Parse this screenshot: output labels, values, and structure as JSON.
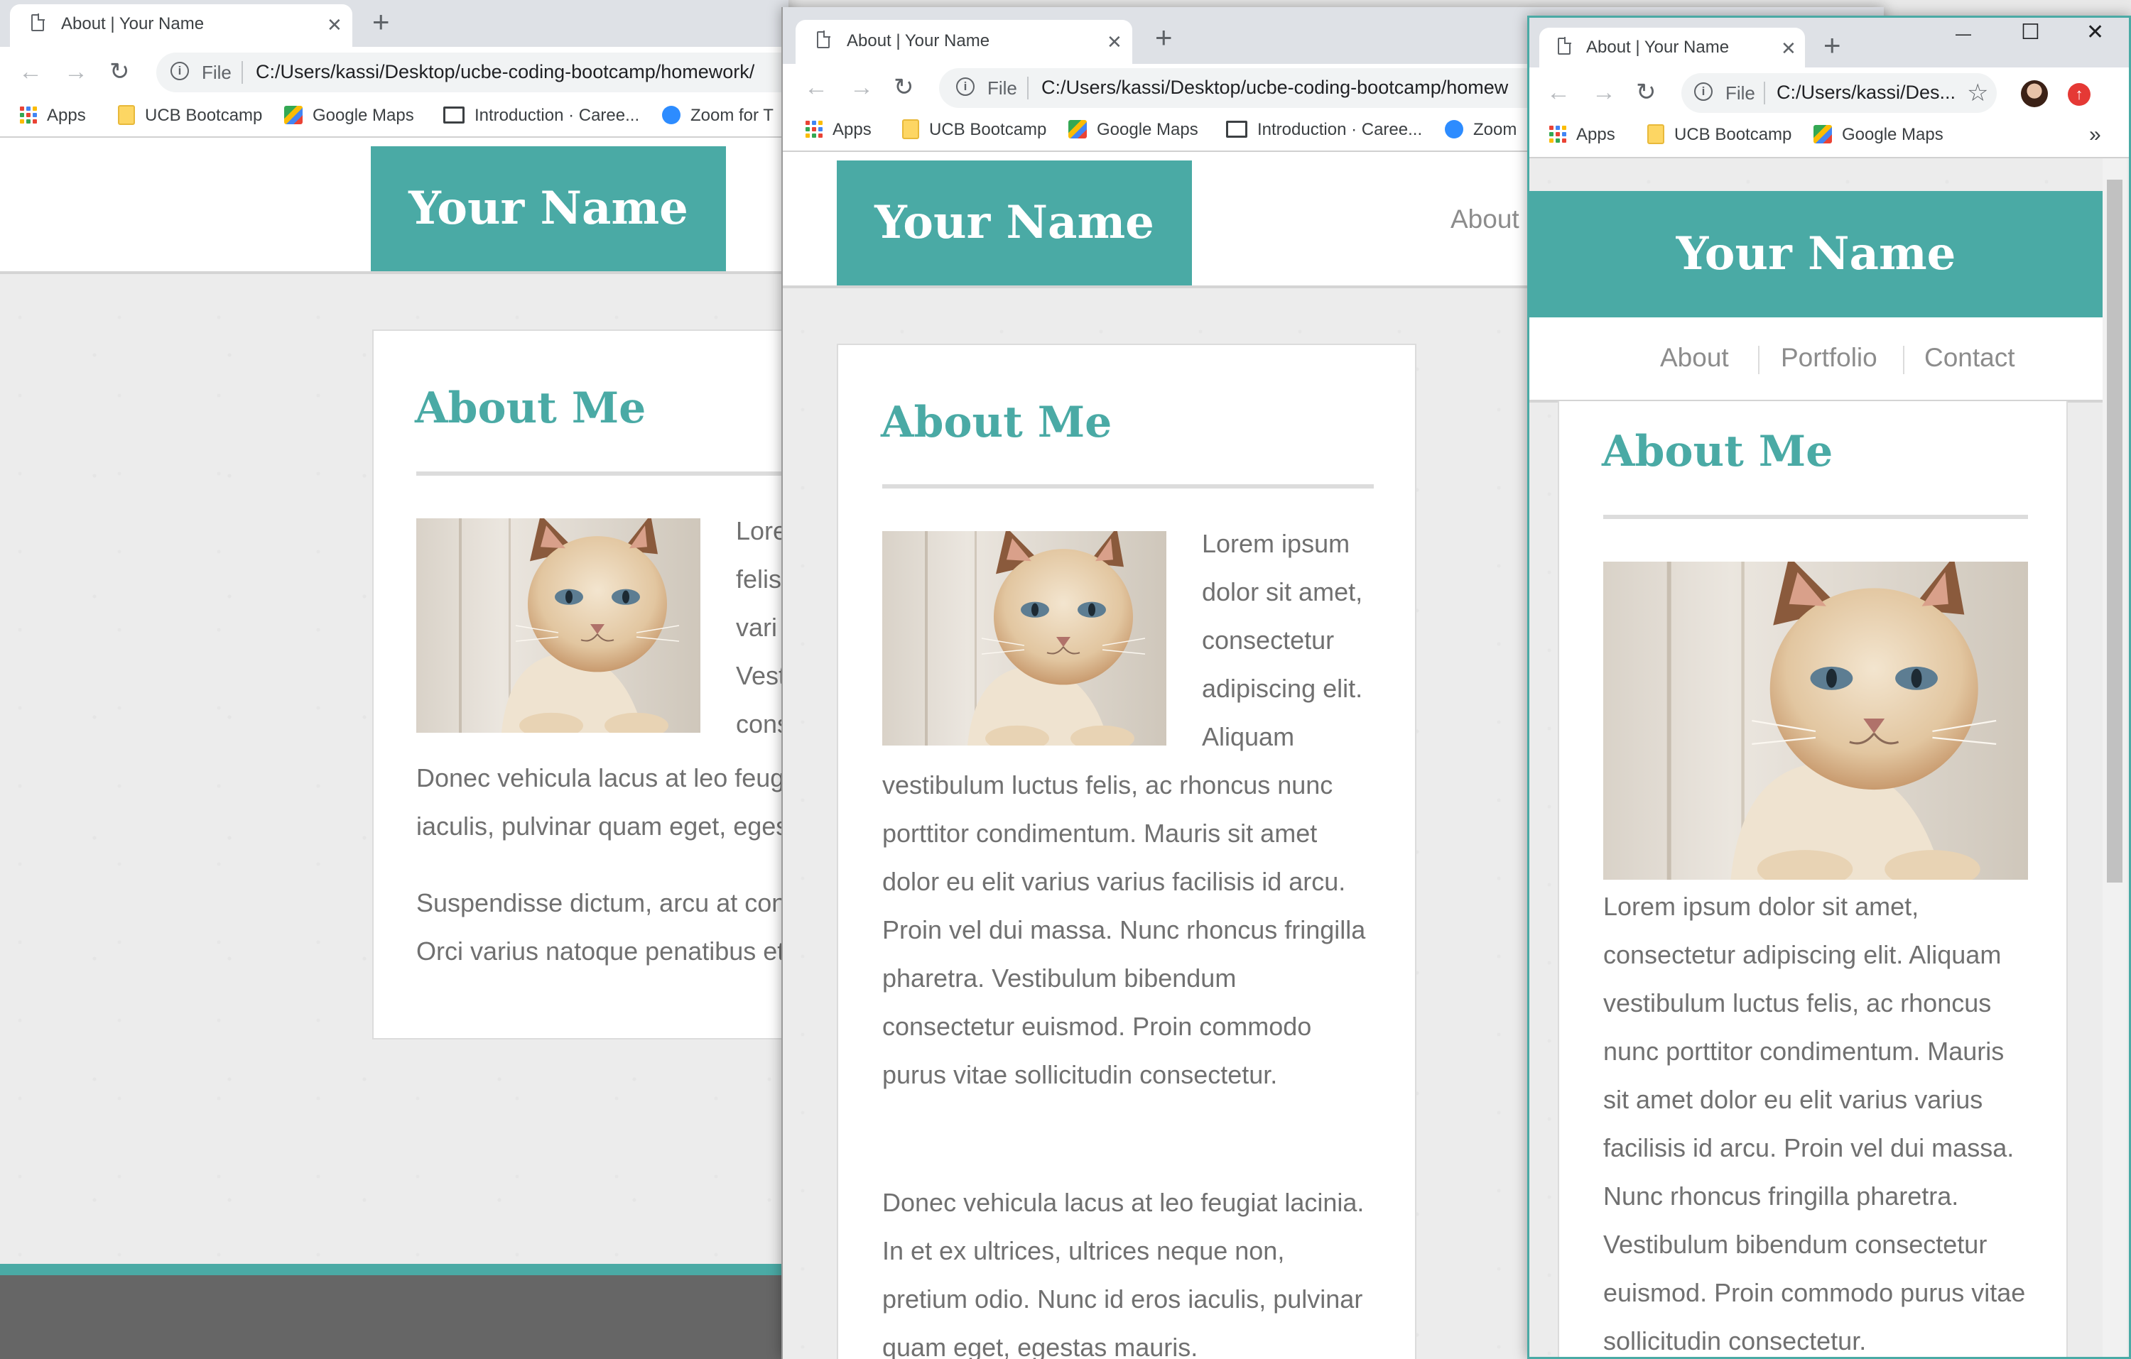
{
  "tab_title": "About | Your Name",
  "omnibox": {
    "file_label": "File",
    "w1_url": "C:/Users/kassi/Desktop/ucbe-coding-bootcamp/homework/",
    "w2_url": "C:/Users/kassi/Desktop/ucbe-coding-bootcamp/homew",
    "w3_url": "C:/Users/kassi/Des..."
  },
  "bookmarks": {
    "apps": "Apps",
    "ucb": "UCB Bootcamp",
    "maps": "Google Maps",
    "intro": "Introduction · Caree...",
    "zoom_w1": "Zoom for T",
    "zoom_w2": "Zoom",
    "overflow": "»"
  },
  "icons": {
    "back": "←",
    "forward": "→",
    "reload": "↻",
    "close": "✕",
    "plus": "+",
    "star": "☆",
    "minimize": "—",
    "maximize": "☐",
    "info": "i"
  },
  "site": {
    "brand": "Your Name",
    "nav": {
      "about": "About",
      "portfolio": "Portfolio",
      "contact": "Contact"
    },
    "heading": "About Me"
  },
  "w1_text": {
    "side_lines": [
      "Lore",
      "felis",
      "vari",
      "Vest",
      "cons"
    ],
    "p2_lines": [
      "Donec vehicula lacus at leo feug",
      "iaculis, pulvinar quam eget, eges"
    ],
    "p3_lines": [
      "Suspendisse dictum, arcu at con",
      "Orci varius natoque penatibus et"
    ]
  },
  "w2_text": {
    "side_lines": [
      "Lorem ipsum",
      "dolor sit amet,",
      "consectetur",
      "adipiscing elit.",
      "Aliquam"
    ],
    "p1_lines": [
      "vestibulum luctus felis, ac rhoncus nunc",
      "porttitor condimentum. Mauris sit amet",
      "dolor eu elit varius varius facilisis id arcu.",
      "Proin vel dui massa. Nunc rhoncus fringilla",
      "pharetra. Vestibulum bibendum",
      "consectetur euismod. Proin commodo",
      "purus vitae sollicitudin consectetur."
    ],
    "p2_lines": [
      "Donec vehicula lacus at leo feugiat lacinia.",
      "In et ex ultrices, ultrices neque non,",
      "pretium odio. Nunc id eros iaculis, pulvinar",
      "quam eget, egestas mauris."
    ]
  },
  "w3_text": {
    "p1_lines": [
      "Lorem ipsum dolor sit amet,",
      "consectetur adipiscing elit. Aliquam",
      "vestibulum luctus felis, ac rhoncus",
      "nunc porttitor condimentum. Mauris",
      "sit amet dolor eu elit varius varius",
      "facilisis id arcu. Proin vel dui massa.",
      "Nunc rhoncus fringilla pharetra.",
      "Vestibulum bibendum consectetur",
      "euismod. Proin commodo purus vitae",
      "sollicitudin consectetur."
    ]
  },
  "colors": {
    "brand_teal": "#4aaaa5",
    "text_gray": "#707070",
    "footer_gray": "#666666"
  }
}
